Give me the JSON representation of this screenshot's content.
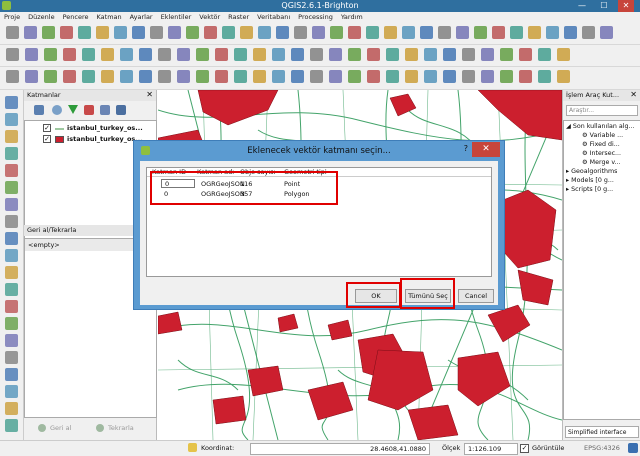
{
  "window": {
    "title": "QGIS2.6.1-Brighton",
    "minimize": "—",
    "maximize": "☐",
    "close": "✕"
  },
  "menu": [
    "Proje",
    "Düzenle",
    "Pencere",
    "Katman",
    "Ayarlar",
    "Eklentiler",
    "Vektör",
    "Raster",
    "Veritabanı",
    "Processing",
    "Yardım"
  ],
  "layers_panel": {
    "title": "Katmanlar",
    "close": "✕",
    "layers": [
      {
        "name": "istanbul_turkey_os...",
        "symbol": "line",
        "color": "#9ec8a0"
      },
      {
        "name": "istanbul_turkey_os...",
        "symbol": "fill",
        "color": "#cc1f2e"
      }
    ]
  },
  "undo_panel": {
    "title": "Geri al/Tekrarla",
    "close": "✕",
    "empty": "<empty>",
    "undo": "Geri al",
    "redo": "Tekrarla"
  },
  "toolbox": {
    "title": "İşlem Araç Kut...",
    "close": "✕",
    "search_placeholder": "Araştır...",
    "tree": [
      "Son kullanılan alg...",
      "Variable ...",
      "Fixed di...",
      "Intersec...",
      "Merge v...",
      "Geoalgorithms",
      "Models [0 g...",
      "Scripts [0 g..."
    ],
    "mode": "Simplified interface"
  },
  "statusbar": {
    "coord_label": "Koordinat:",
    "coord_value": "28.4608,41.0880",
    "scale_label": "Ölçek",
    "scale_value": "1:126.109",
    "render_label": "Görüntüle",
    "crs": "EPSG:4326"
  },
  "dialog": {
    "title": "Eklenecek vektör katmanı seçin...",
    "help": "?",
    "close": "✕",
    "headers": [
      "Katman ID",
      "Katman adı",
      "Obje sayısı",
      "Geometri tipi"
    ],
    "rows": [
      [
        "0",
        "OGRGeoJSON",
        "116",
        "Point"
      ],
      [
        "0",
        "OGRGeoJSON",
        "357",
        "Polygon"
      ]
    ],
    "ok": "OK",
    "select_all": "Tümünü Seç",
    "cancel": "Cancel"
  },
  "colors": {
    "accent": "#2f6f9f",
    "highlight": "#e00000",
    "map_poly": "#cc1f2e",
    "map_roads": "#2f9a5a"
  }
}
